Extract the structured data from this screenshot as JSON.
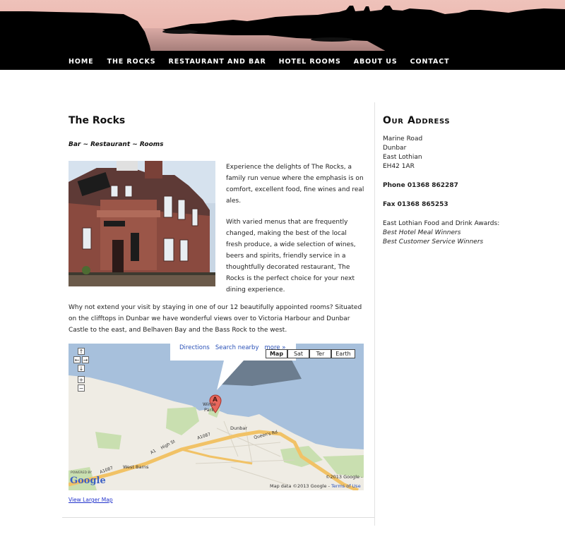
{
  "nav": {
    "items": [
      "HOME",
      "THE ROCKS",
      "RESTAURANT AND BAR",
      "HOTEL ROOMS",
      "ABOUT US",
      "CONTACT"
    ]
  },
  "colors": {
    "header_sky": "#e9b3ab",
    "header_dark": "#000000",
    "link_blue": "#2233cc"
  },
  "main": {
    "title": "The Rocks",
    "tagline": "Bar ~ Restaurant ~ Rooms",
    "intro_p1": "Experience the delights of The Rocks, a family run venue where the emphasis is on comfort, excellent food, fine wines and real ales.",
    "intro_p2": "With varied menus that are frequently changed, making the best of the local fresh produce, a wide selection of wines, beers and spirits, friendly service in a thoughtfully decorated restaurant, The Rocks is the perfect choice for your next dining experience.",
    "para3": "Why not extend your visit by staying in one of our 12 beautifully appointed rooms? Situated on the clifftops in Dunbar we have wonderful views over to Victoria Harbour and Dunbar Castle to the east, and Belhaven Bay and the Bass Rock to the west.",
    "view_larger_map": "View Larger Map"
  },
  "map": {
    "info_links": [
      "Directions",
      "Search nearby",
      "more »"
    ],
    "types": [
      "Map",
      "Sat",
      "Ter",
      "Earth"
    ],
    "active_type": "Map",
    "controls": [
      "↑",
      "←",
      "→",
      "↓",
      "+",
      "−"
    ],
    "marker": "A",
    "places": {
      "winterfield": "Winte",
      "park": "Park",
      "dunbar": "Dunbar",
      "west_barns": "West Barns"
    },
    "roads": {
      "a1087_a": "A1087",
      "a1087_b": "A1087",
      "high_st": "High St",
      "queens_rd": "Queen's Rd",
      "b": "A1",
      "c": "A1087"
    },
    "copyright": "©2013 Google -",
    "attribution": "Map data ©2013 Google -",
    "terms": "Terms of Use",
    "logo_powered": "POWERED BY",
    "logo_google": "Google"
  },
  "sidebar": {
    "title": "Our Address",
    "address": [
      "Marine Road",
      "Dunbar",
      "East Lothian",
      "EH42 1AR"
    ],
    "phone": "Phone 01368 862287",
    "fax": "Fax 01368 865253",
    "awards_label": "East Lothian Food and Drink Awards:",
    "awards": [
      "Best Hotel Meal Winners",
      "Best Customer Service Winners"
    ]
  }
}
